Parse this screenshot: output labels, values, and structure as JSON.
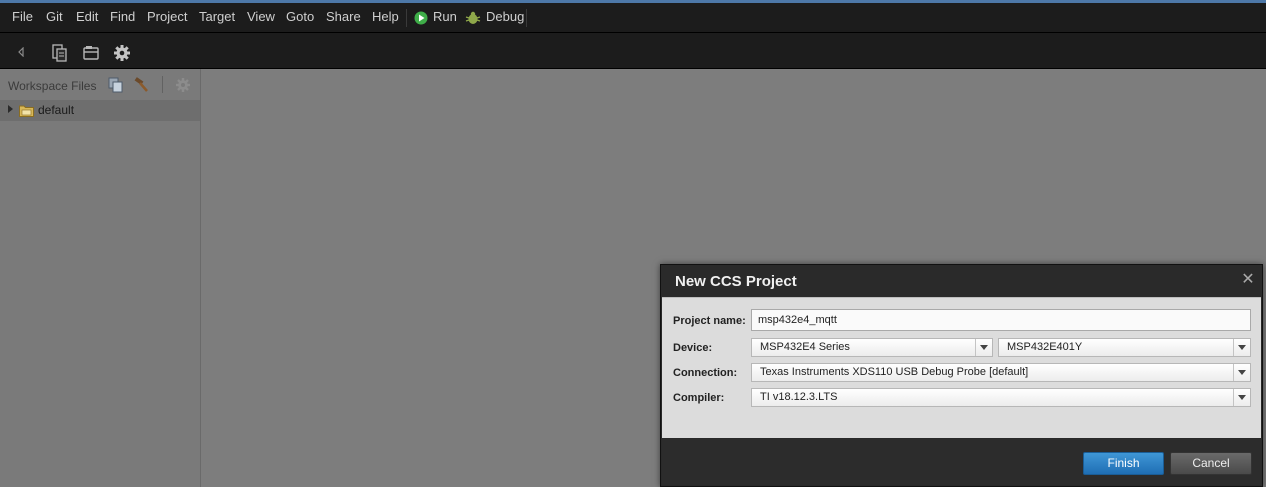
{
  "menubar": {
    "items": [
      "File",
      "Git",
      "Edit",
      "Find",
      "Project",
      "Target",
      "View",
      "Goto",
      "Share",
      "Help"
    ],
    "run_label": "Run",
    "debug_label": "Debug"
  },
  "toolbar": {
    "icons": [
      "back-arrow-icon",
      "new-file-icon",
      "project-icon",
      "gear-icon"
    ]
  },
  "sidebar": {
    "title": "Workspace Files",
    "tree": [
      {
        "label": "default",
        "expanded": false
      }
    ]
  },
  "dialog": {
    "title": "New CCS Project",
    "project_name_label": "Project name:",
    "project_name_value": "msp432e4_mqtt",
    "device_label": "Device:",
    "device_family": "MSP432E4 Series",
    "device_variant": "MSP432E401Y",
    "connection_label": "Connection:",
    "connection_value": "Texas Instruments XDS110 USB Debug Probe [default]",
    "compiler_label": "Compiler:",
    "compiler_value": "TI v18.12.3.LTS",
    "finish_label": "Finish",
    "cancel_label": "Cancel"
  },
  "colors": {
    "menubar_bg": "#1c1c1c",
    "accent_top": "#4d78a8",
    "workspace_bg": "#7d7d7d",
    "finish_button": "#2a7fc4",
    "run_icon": "#3fae49"
  }
}
